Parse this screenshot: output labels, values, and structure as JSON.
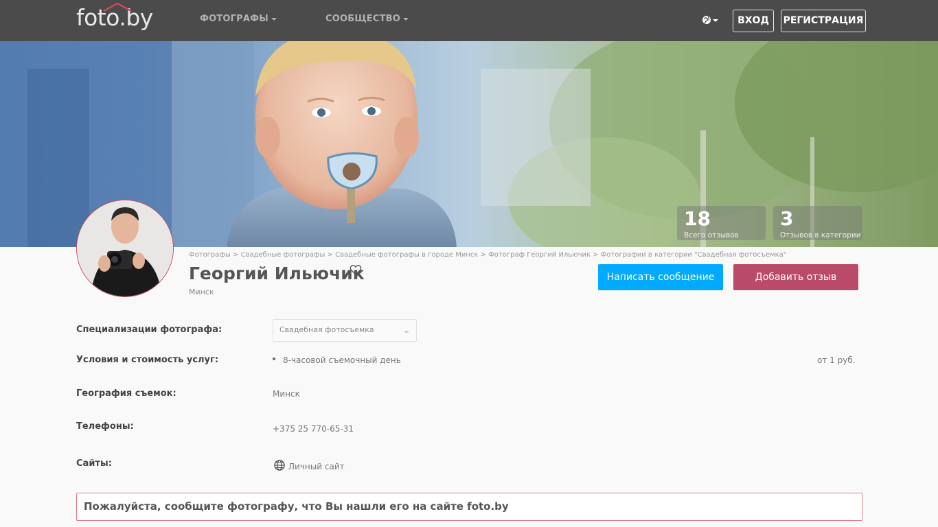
{
  "nav": {
    "logo": "foto.by",
    "photographers": "ФОТОГРАФЫ",
    "community": "СООБЩЕСТВО",
    "login": "ВХОД",
    "register": "РЕГИСТРАЦИЯ",
    "language_icon": "globe-icon"
  },
  "stats": [
    {
      "value": "18",
      "label": "Всего отзывов"
    },
    {
      "value": "3",
      "label": "Отзывов в категории"
    }
  ],
  "breadcrumb": "Фотографы > Свадебные фотографы > Свадебные фотографы в городе Минск > Фотограф Георгий Ильючик > Фотографии в категории \"Свадебная фотосъемка\"",
  "profile": {
    "name": "Георгий Ильючик",
    "city": "Минск",
    "message_button": "Написать сообщение",
    "review_button": "Добавить отзыв"
  },
  "details": {
    "specializations_label": "Специализации фотографа:",
    "specialization_selected": "Свадебная фотосъемка",
    "services_label": "Условия и стоимость услуг:",
    "service_name": "8-часовой съемочный день",
    "service_price": "от 1 руб.",
    "geography_label": "География съемок:",
    "geography_value": "Минск",
    "phones_label": "Телефоны:",
    "phone_value": "+375 25 770-65-31",
    "sites_label": "Сайты:",
    "site_value": "Личный сайт"
  },
  "notice": "Пожалуйста, сообщите фотографу, что Вы нашли его на сайте foto.by",
  "colors": {
    "topbar": "#4b4b4b",
    "message_button": "#00aaff",
    "review_button": "#b94b69",
    "notice_border": "#e07b85"
  }
}
